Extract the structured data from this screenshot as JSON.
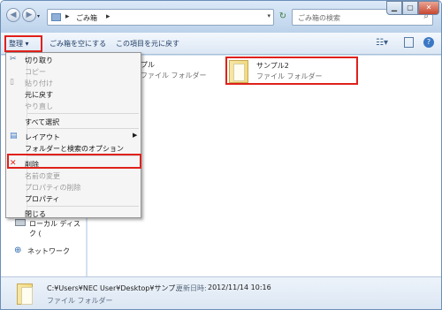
{
  "address": {
    "crumb": "ごみ箱",
    "sep": "▸"
  },
  "search": {
    "placeholder": "ごみ箱の検索"
  },
  "toolbar": {
    "organize": "整理 ▾",
    "empty_bin": "ごみ箱を空にする",
    "restore": "この項目を元に戻す"
  },
  "menu": {
    "items": [
      {
        "label": "切り取り",
        "enabled": true
      },
      {
        "label": "コピー",
        "enabled": false
      },
      {
        "label": "貼り付け",
        "enabled": false
      },
      {
        "label": "元に戻す",
        "enabled": true
      },
      {
        "label": "やり直し",
        "enabled": false
      },
      {
        "label": "すべて選択",
        "enabled": true
      },
      {
        "label": "レイアウト",
        "enabled": true
      },
      {
        "label": "フォルダーと検索のオプション",
        "enabled": true
      },
      {
        "label": "削除",
        "enabled": true
      },
      {
        "label": "名前の変更",
        "enabled": false
      },
      {
        "label": "プロパティの削除",
        "enabled": false
      },
      {
        "label": "プロパティ",
        "enabled": true
      },
      {
        "label": "閉じる",
        "enabled": true
      }
    ]
  },
  "files": [
    {
      "name": "サンプル1",
      "partial": "プル",
      "type": "ファイル フォルダー"
    },
    {
      "name": "サンプル2",
      "type": "ファイル フォルダー"
    }
  ],
  "nav": {
    "local_disk": "ローカル ディスク (",
    "network": "ネットワーク"
  },
  "details": {
    "path": "C:¥Users¥NEC User¥Desktop¥サンプ...",
    "date_label": "更新日時:",
    "date": "2012/11/14 10:16",
    "type": "ファイル フォルダー"
  }
}
